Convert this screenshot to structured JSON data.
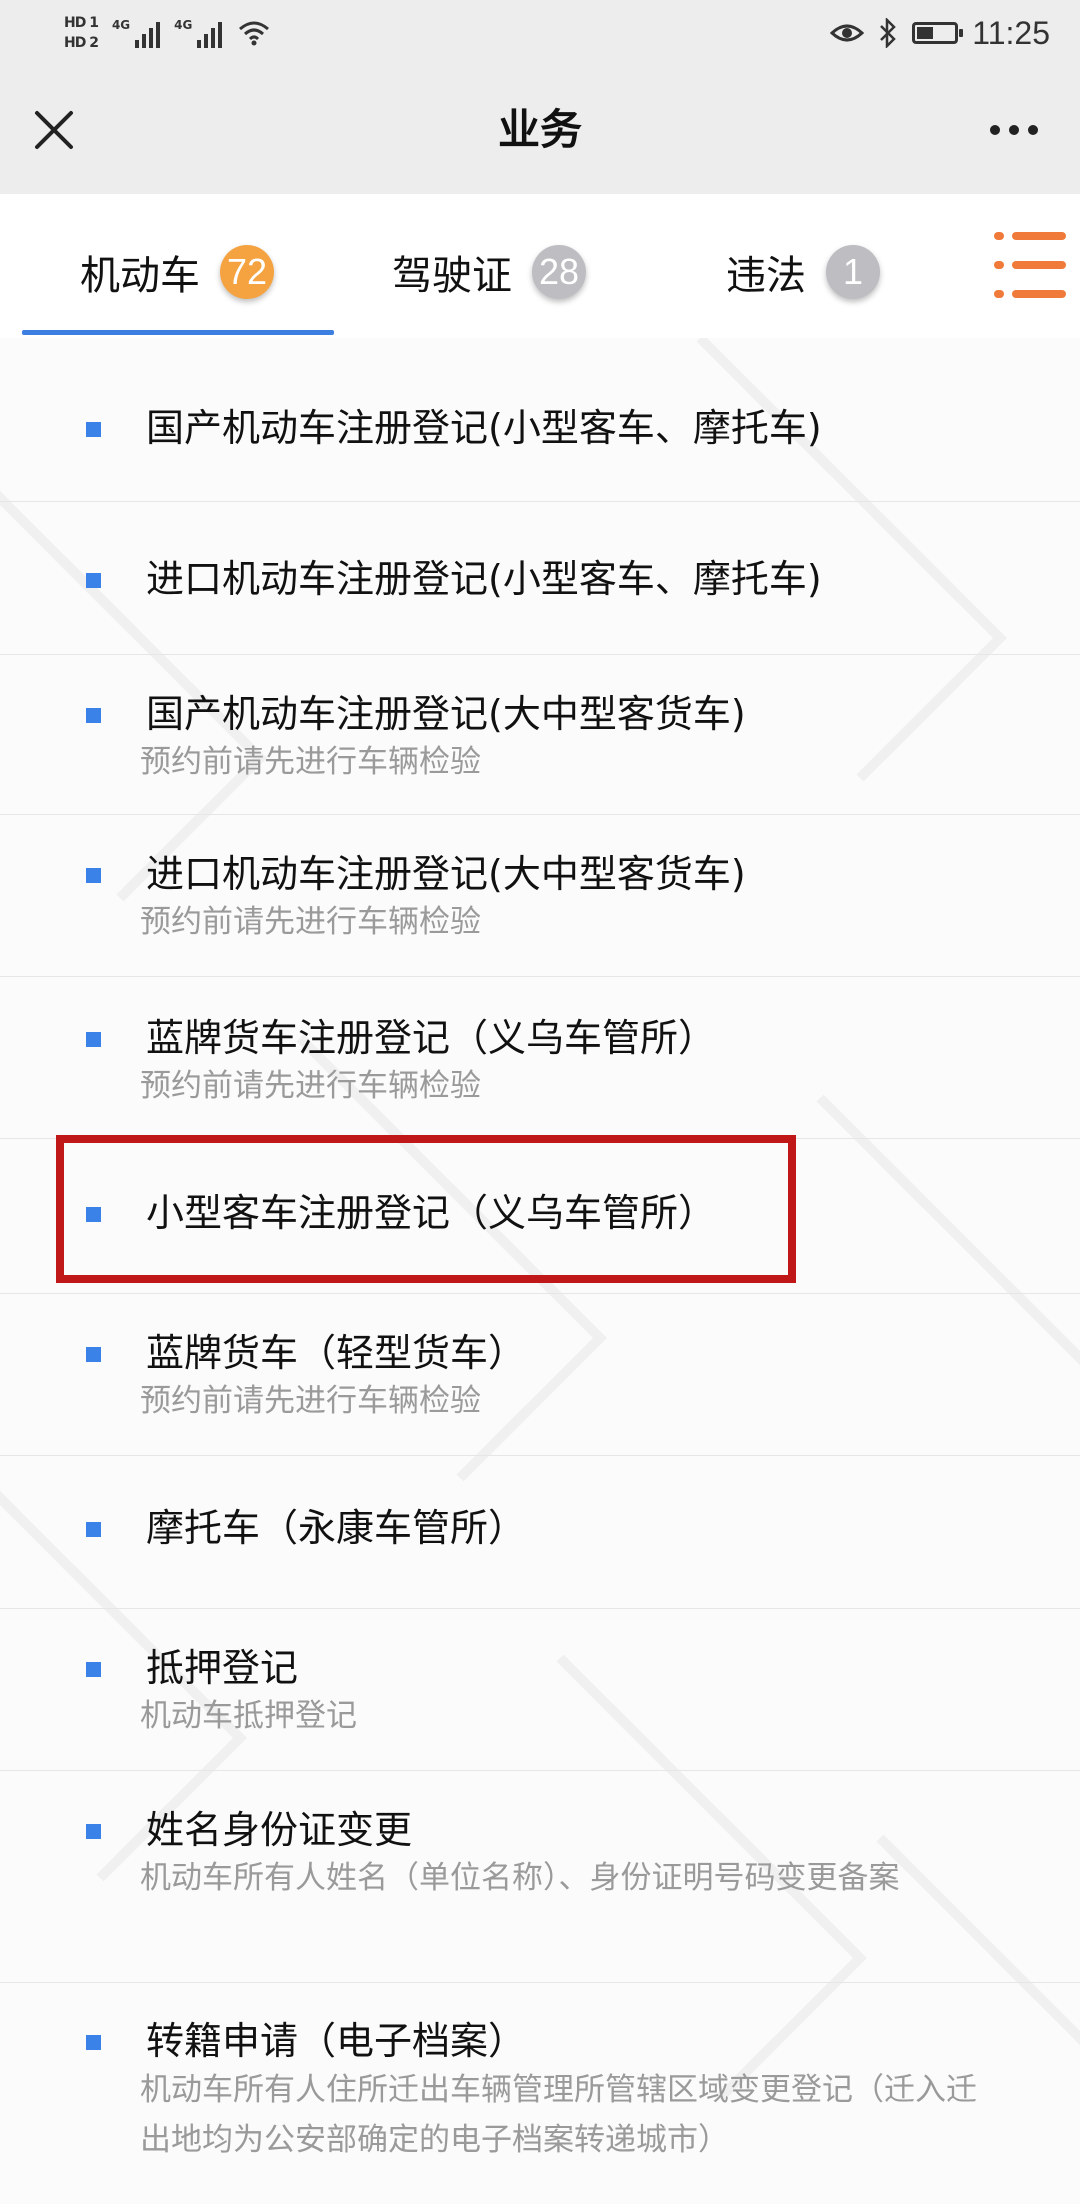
{
  "status_bar": {
    "hd1": "HD 1",
    "hd2": "HD 2",
    "network1": "4G",
    "network2": "4G",
    "time": "11:25",
    "battery_level": 0.45
  },
  "nav": {
    "title": "业务",
    "close_icon": "close-icon",
    "more_icon": "more-icon"
  },
  "tabs": [
    {
      "label": "机动车",
      "badge": "72",
      "active": true
    },
    {
      "label": "驾驶证",
      "badge": "28",
      "active": false
    },
    {
      "label": "违法",
      "badge": "1",
      "active": false
    }
  ],
  "colors": {
    "accent": "#3d7fe0",
    "badge_active": "#f4a340",
    "badge_inactive": "#bdbdc2",
    "menu_icon": "#f07a3a",
    "highlight": "#c01818"
  },
  "list": {
    "items": [
      {
        "title": "国产机动车注册登记(小型客车、摩托车)",
        "sub": ""
      },
      {
        "title": "进口机动车注册登记(小型客车、摩托车)",
        "sub": ""
      },
      {
        "title": "国产机动车注册登记(大中型客货车)",
        "sub": "预约前请先进行车辆检验"
      },
      {
        "title": "进口机动车注册登记(大中型客货车)",
        "sub": "预约前请先进行车辆检验"
      },
      {
        "title": "蓝牌货车注册登记（义乌车管所）",
        "sub": "预约前请先进行车辆检验"
      },
      {
        "title": "小型客车注册登记（义乌车管所）",
        "sub": "",
        "highlighted": true
      },
      {
        "title": "蓝牌货车（轻型货车）",
        "sub": "预约前请先进行车辆检验"
      },
      {
        "title": "摩托车（永康车管所）",
        "sub": ""
      },
      {
        "title": "抵押登记",
        "sub": "机动车抵押登记"
      },
      {
        "title": "姓名身份证变更",
        "sub": "机动车所有人姓名（单位名称）、身份证明号码变更备案"
      },
      {
        "title": "转籍申请（电子档案）",
        "sub": "机动车所有人住所迁出车辆管理所管辖区域变更登记（迁入迁出地均为公安部确定的电子档案转递城市）"
      }
    ]
  }
}
